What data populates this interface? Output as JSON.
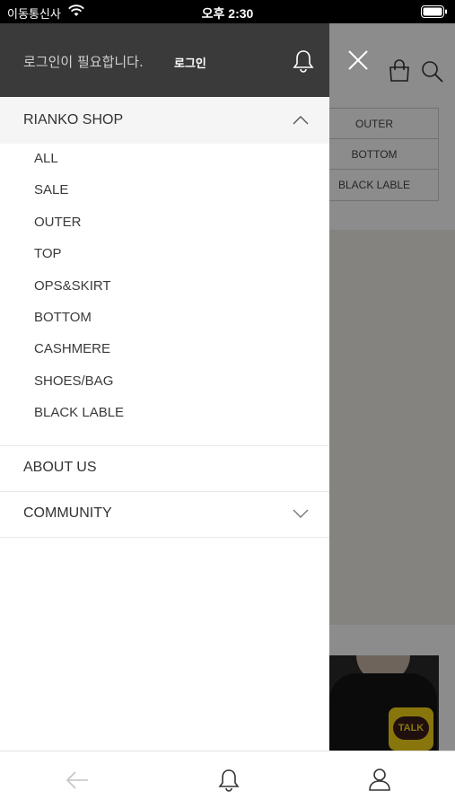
{
  "status_bar": {
    "carrier": "이동통신사",
    "time": "오후 2:30"
  },
  "drawer": {
    "login_message": "로그인이 필요합니다.",
    "login_button": "로그인",
    "shop_section": {
      "title": "RIANKO SHOP",
      "expanded": true,
      "items": [
        "ALL",
        "SALE",
        "OUTER",
        "TOP",
        "OPS&SKIRT",
        "BOTTOM",
        "CASHMERE",
        "SHOES/BAG",
        "BLACK LABLE"
      ]
    },
    "about_label": "ABOUT US",
    "community_label": "COMMUNITY"
  },
  "background_page": {
    "categories": [
      "OUTER",
      "BOTTOM",
      "BLACK LABLE"
    ],
    "talk_button": "TALK"
  },
  "colors": {
    "drawer_header_bg": "#3a3a3a",
    "section_highlight_bg": "#f5f5f5",
    "overlay": "rgba(0,0,0,0.45)",
    "talk_yellow": "#f7d817"
  },
  "icons": [
    "wifi-icon",
    "battery-icon",
    "bell-icon",
    "chevron-up-icon",
    "chevron-down-icon",
    "close-icon",
    "shopping-bag-icon",
    "search-icon",
    "back-arrow-icon",
    "user-icon"
  ]
}
